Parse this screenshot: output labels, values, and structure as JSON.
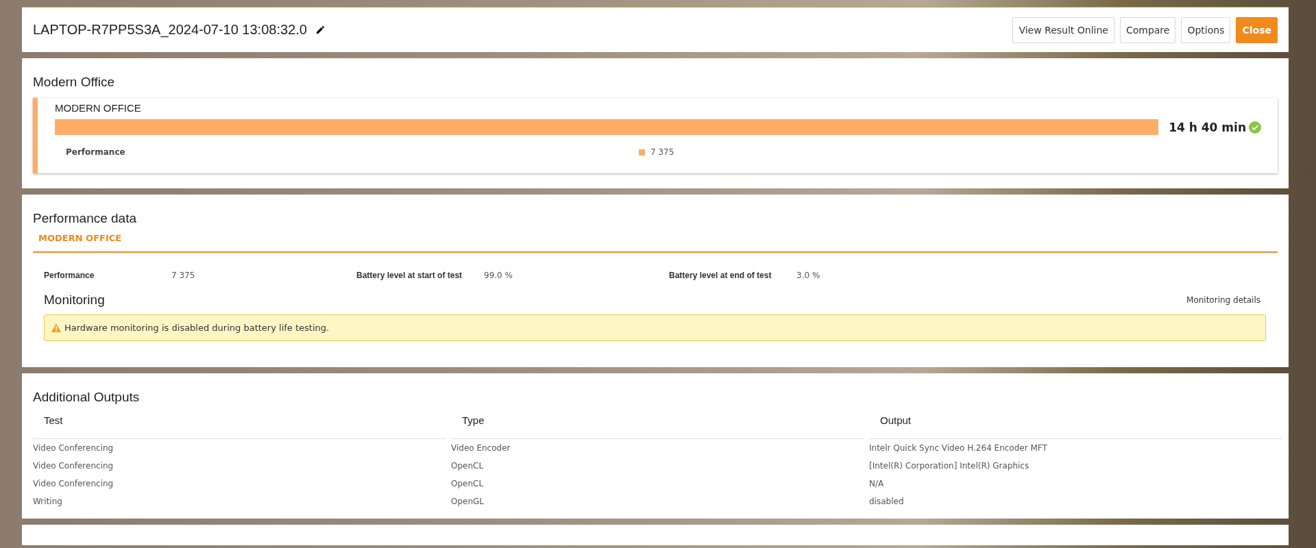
{
  "header": {
    "title": "LAPTOP-R7PP5S3A_2024-07-10 13:08:32.0",
    "buttons": [
      {
        "label": "View Result Online",
        "kind": "default"
      },
      {
        "label": "Compare",
        "kind": "default"
      },
      {
        "label": "Options",
        "kind": "default"
      },
      {
        "label": "Close",
        "kind": "primary"
      }
    ]
  },
  "summary": {
    "heading": "Modern Office",
    "card": {
      "title": "MODERN OFFICE",
      "result": "14 h 40 min",
      "passed": true,
      "legend_label": "Performance",
      "legend_value": "7 375"
    }
  },
  "performance_data": {
    "heading": "Performance data",
    "tabs": [
      {
        "label": "MODERN OFFICE",
        "selected": true
      }
    ],
    "fields": [
      {
        "label": "Performance",
        "value": "7 375"
      },
      {
        "label": "Battery level at start of test",
        "value": "99.0 %"
      },
      {
        "label": "Battery level at end of test",
        "value": "3.0 %"
      }
    ],
    "monitoring": {
      "heading": "Monitoring",
      "link": "Monitoring details",
      "warning": "Hardware monitoring is disabled during battery life testing."
    }
  },
  "additional_outputs": {
    "heading": "Additional Outputs",
    "columns": [
      "Test",
      "Type",
      "Output"
    ],
    "rows": [
      [
        "Video Conferencing",
        "Video Encoder",
        "Intelr Quick Sync Video H.264 Encoder MFT"
      ],
      [
        "Video Conferencing",
        "OpenCL",
        "[Intel(R) Corporation] Intel(R) Graphics"
      ],
      [
        "Video Conferencing",
        "OpenCL",
        "N/A"
      ],
      [
        "Writing",
        "OpenGL",
        "disabled"
      ]
    ]
  }
}
